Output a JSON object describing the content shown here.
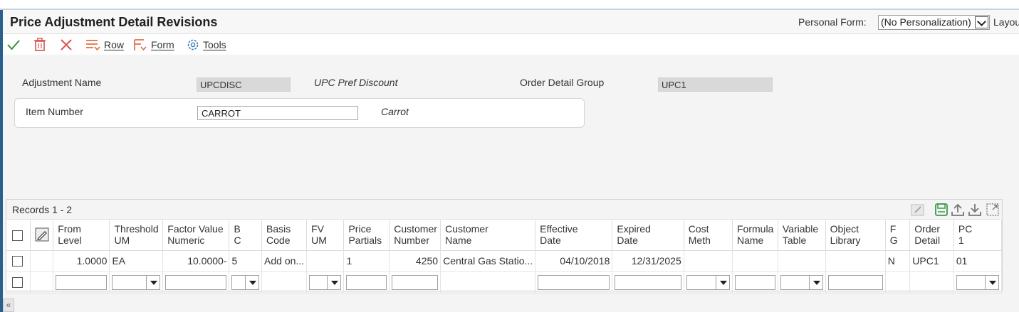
{
  "header": {
    "title": "Price Adjustment Detail Revisions",
    "personal_form_label": "Personal Form:",
    "personal_form_value": "(No Personalization)",
    "layout_label": "Layou"
  },
  "toolbar": {
    "row_label": "Row",
    "form_label": "Form",
    "tools_label": "Tools"
  },
  "form": {
    "adjustment_name_label": "Adjustment Name",
    "adjustment_name_value": "UPCDISC",
    "adjustment_desc": "UPC Pref Discount",
    "order_detail_group_label": "Order Detail Group",
    "order_detail_group_value": "UPC1",
    "item_number_label": "Item Number",
    "item_number_value": "CARROT",
    "item_desc": "Carrot"
  },
  "grid": {
    "records_label": "Records 1 - 2",
    "columns": [
      {
        "key": "from_level",
        "line1": "From",
        "line2": "Level"
      },
      {
        "key": "threshold_um",
        "line1": "Threshold",
        "line2": "UM"
      },
      {
        "key": "factor_value",
        "line1": "Factor Value",
        "line2": "Numeric"
      },
      {
        "key": "bc",
        "line1": "B",
        "line2": "C"
      },
      {
        "key": "basis_code",
        "line1": "Basis",
        "line2": "Code"
      },
      {
        "key": "fv_um",
        "line1": "FV",
        "line2": "UM"
      },
      {
        "key": "price_partials",
        "line1": "Price",
        "line2": "Partials"
      },
      {
        "key": "customer_number",
        "line1": "Customer",
        "line2": "Number"
      },
      {
        "key": "customer_name",
        "line1": "Customer",
        "line2": "Name"
      },
      {
        "key": "effective_date",
        "line1": "Effective",
        "line2": "Date"
      },
      {
        "key": "expired_date",
        "line1": "Expired",
        "line2": "Date"
      },
      {
        "key": "cost_meth",
        "line1": "Cost",
        "line2": "Meth"
      },
      {
        "key": "formula_name",
        "line1": "Formula",
        "line2": "Name"
      },
      {
        "key": "variable_table",
        "line1": "Variable",
        "line2": "Table"
      },
      {
        "key": "object_library",
        "line1": "Object",
        "line2": "Library"
      },
      {
        "key": "fg",
        "line1": "F",
        "line2": "G"
      },
      {
        "key": "order_detail",
        "line1": "Order",
        "line2": "Detail"
      },
      {
        "key": "pc1",
        "line1": "PC",
        "line2": "1"
      }
    ],
    "row1": {
      "from_level": "1.0000",
      "threshold_um": "EA",
      "factor_value": "10.0000-",
      "bc": "5",
      "basis_code": "Add on...",
      "fv_um": "",
      "price_partials": "1",
      "customer_number": "4250",
      "customer_name": "Central Gas Statio...",
      "effective_date": "04/10/2018",
      "expired_date": "12/31/2025",
      "cost_meth": "",
      "formula_name": "",
      "variable_table": "",
      "object_library": "",
      "fg": "N",
      "order_detail": "UPC1",
      "pc1": "01"
    }
  },
  "collapse_glyph": "«"
}
